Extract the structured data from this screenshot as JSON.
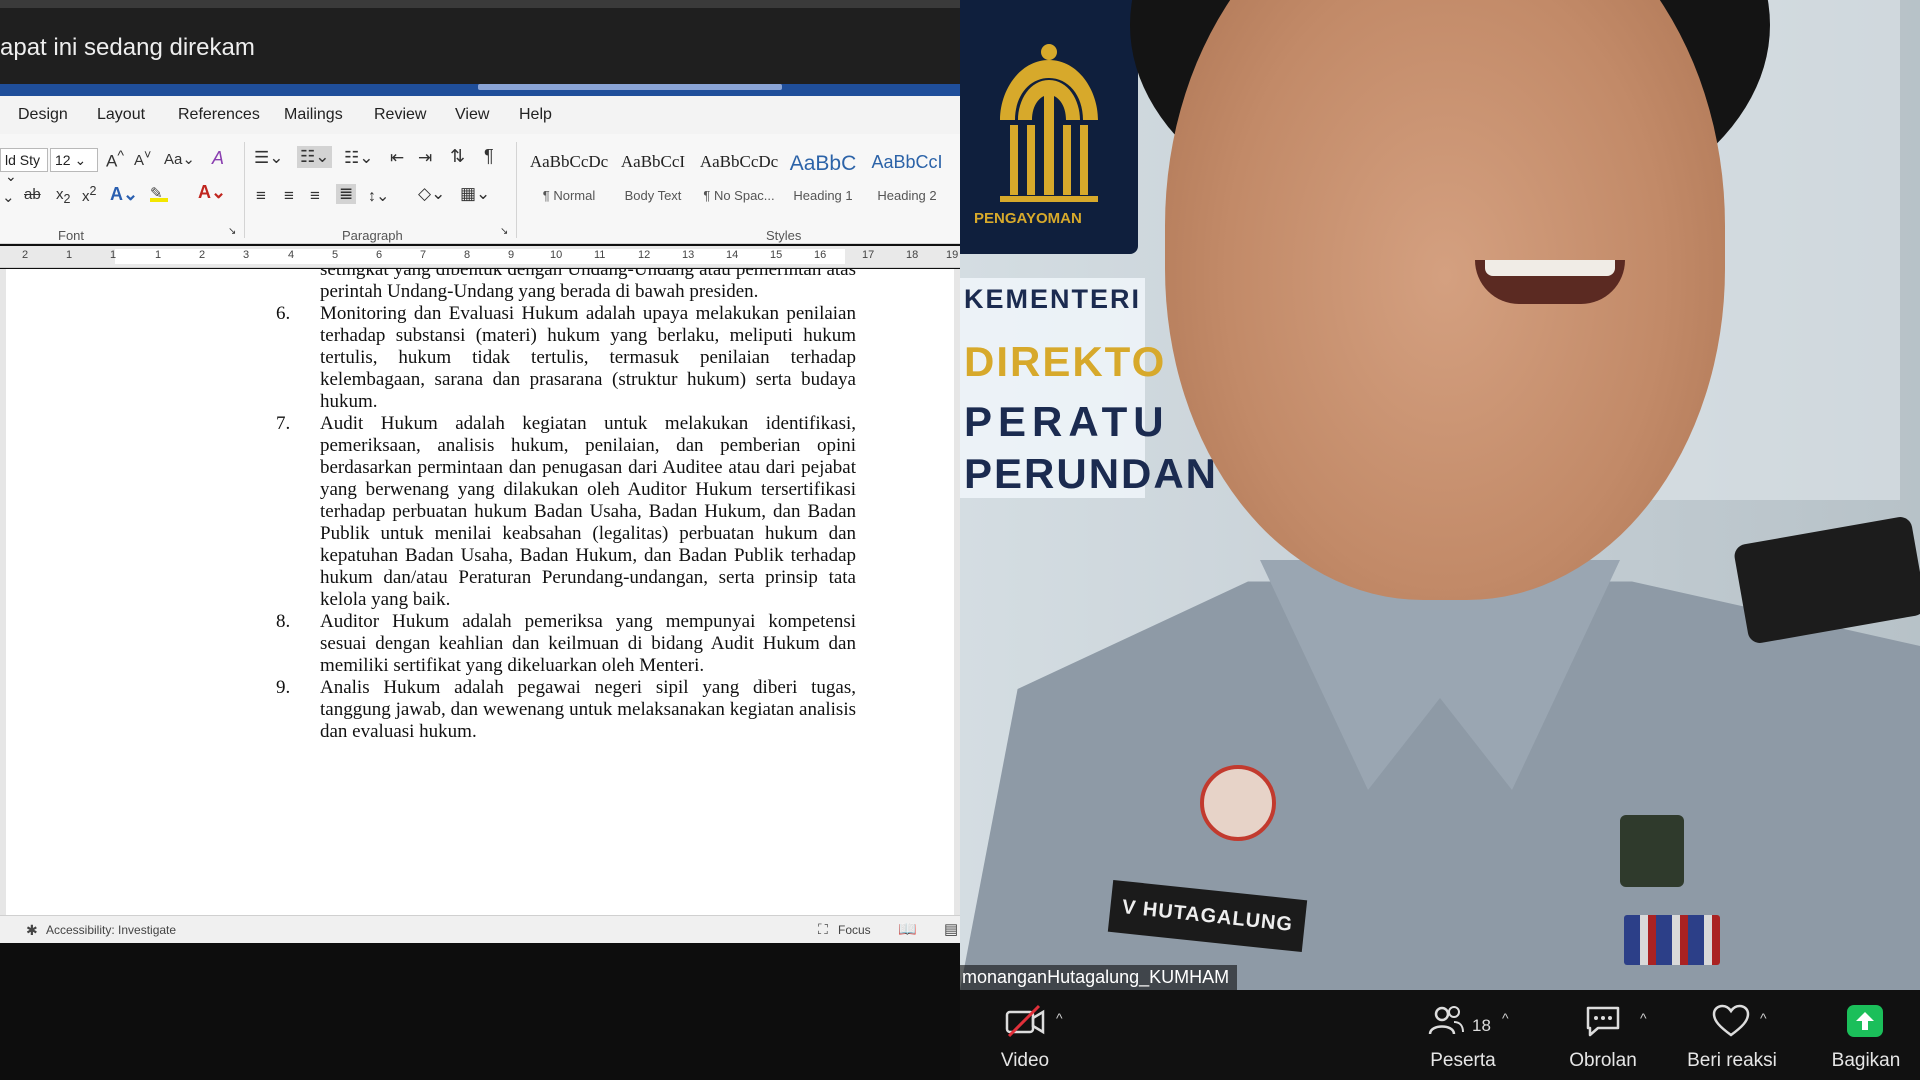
{
  "recording_bar": {
    "text": "apat ini sedang direkam"
  },
  "ribbon": {
    "tabs": [
      "Design",
      "Layout",
      "References",
      "Mailings",
      "Review",
      "View",
      "Help"
    ],
    "font_name": "ld Sty",
    "font_size": "12",
    "group_labels": {
      "font": "Font",
      "paragraph": "Paragraph",
      "styles": "Styles"
    },
    "styles": [
      {
        "preview": "AaBbCcDc",
        "name": "¶ Normal"
      },
      {
        "preview": "AaBbCcI",
        "name": "Body Text"
      },
      {
        "preview": "AaBbCcDc",
        "name": "¶ No Spac..."
      },
      {
        "preview": "AaBbC",
        "name": "Heading 1"
      },
      {
        "preview": "AaBbCcI",
        "name": "Heading 2"
      }
    ]
  },
  "ruler": {
    "numbers": [
      "2",
      "1",
      "1",
      "1",
      "2",
      "3",
      "4",
      "5",
      "6",
      "7",
      "8",
      "9",
      "10",
      "11",
      "12",
      "13",
      "14",
      "15",
      "16",
      "17",
      "18",
      "19"
    ]
  },
  "document": {
    "items": [
      {
        "num": "",
        "text": "setingkat yang dibentuk dengan Undang-Undang atau pemerintah atas perintah Undang-Undang yang berada di bawah presiden."
      },
      {
        "num": "6.",
        "text": "Monitoring dan Evaluasi Hukum adalah upaya melakukan penilaian terhadap substansi (materi) hukum yang berlaku, meliputi hukum tertulis, hukum tidak tertulis, termasuk penilaian terhadap kelembagaan, sarana dan prasarana (struktur hukum) serta budaya hukum."
      },
      {
        "num": "7.",
        "text": "Audit Hukum adalah kegiatan untuk melakukan identifikasi, pemeriksaan, analisis hukum, penilaian, dan pemberian opini berdasarkan permintaan dan penugasan dari Auditee atau dari pejabat yang berwenang yang dilakukan oleh Auditor Hukum tersertifikasi terhadap perbuatan hukum Badan Usaha, Badan Hukum, dan Badan Publik untuk menilai keabsahan (legalitas) perbuatan hukum dan kepatuhan Badan Usaha, Badan Hukum, dan Badan Publik terhadap hukum dan/atau Peraturan Perundang-undangan, serta prinsip tata kelola yang baik."
      },
      {
        "num": "8.",
        "text": "Auditor Hukum adalah pemeriksa yang mempunyai kompetensi sesuai dengan keahlian dan keilmuan di bidang Audit Hukum dan memiliki sertifikat yang dikeluarkan oleh Menteri."
      },
      {
        "num": "9.",
        "text": "Analis Hukum adalah pegawai negeri sipil yang diberi tugas, tanggung jawab, dan wewenang untuk melaksanakan kegiatan analisis dan evaluasi hukum."
      }
    ]
  },
  "statusbar": {
    "accessibility": "Accessibility: Investigate",
    "focus": "Focus"
  },
  "video": {
    "banner_logo_text": "PENGAYOMAN",
    "banner_lines": [
      "KEMENTERI",
      "DIREKTO",
      "PERATU",
      "PERUNDAN"
    ],
    "nametag": "V HUTAGALUNG",
    "participant_name": "monanganHutagalung_KUMHAM"
  },
  "toolbar": {
    "video_label": "Video",
    "participants_label": "Peserta",
    "participants_count": "18",
    "chat_label": "Obrolan",
    "reactions_label": "Beri reaksi",
    "share_label": "Bagikan"
  },
  "colors": {
    "word_blue": "#1f4e9a",
    "heading_blue": "#2c63a8",
    "share_green": "#1bbf5a",
    "logo_gold": "#d7a92b"
  }
}
